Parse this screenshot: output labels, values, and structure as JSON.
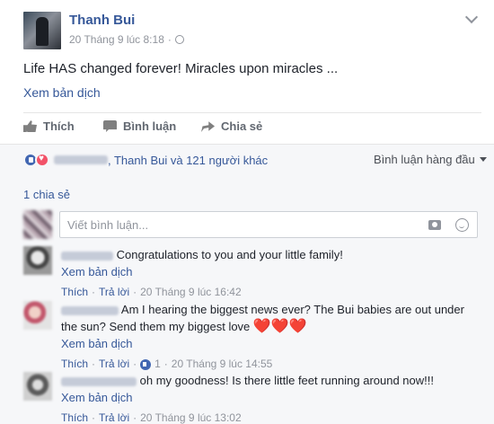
{
  "post": {
    "author": "Thanh Bui",
    "timestamp": "20 Tháng 9 lúc 8:18",
    "separator": "·",
    "text": "Life HAS changed forever! Miracles upon miracles ...",
    "see_translation": "Xem bản dịch",
    "icons": {
      "privacy": "globe-icon",
      "menu": "chevron-down-icon"
    }
  },
  "actions": {
    "like": "Thích",
    "comment": "Bình luận",
    "share": "Chia sẻ"
  },
  "reactions": {
    "summary_suffix": ", Thanh Bui và 121 người khác",
    "types": [
      "like",
      "love"
    ],
    "sort_label": "Bình luận hàng đầu"
  },
  "shares_label": "1 chia sẻ",
  "comment_box": {
    "placeholder": "Viết bình luận..."
  },
  "comments": [
    {
      "text": "Congratulations to you and your little family!",
      "translate": "Xem bản dịch",
      "like": "Thích",
      "reply": "Trả lời",
      "time": "20 Tháng 9 lúc 16:42"
    },
    {
      "text": "Am I hearing the biggest news ever? The Bui babies are out under the sun? Send them my biggest love",
      "hearts": "❤️❤️❤️",
      "translate": "Xem bản dịch",
      "like": "Thích",
      "reply": "Trả lời",
      "like_count": "1",
      "time": "20 Tháng 9 lúc 14:55"
    },
    {
      "text": "oh my goodness! Is there little feet running around now!!!",
      "translate": "Xem bản dịch",
      "like": "Thích",
      "reply": "Trả lời",
      "time": "20 Tháng 9 lúc 13:02"
    }
  ],
  "colors": {
    "link": "#365899",
    "muted": "#90949c",
    "panel_bg": "#f6f7f9",
    "like_blue": "#4267b2",
    "love_red": "#f25268"
  }
}
